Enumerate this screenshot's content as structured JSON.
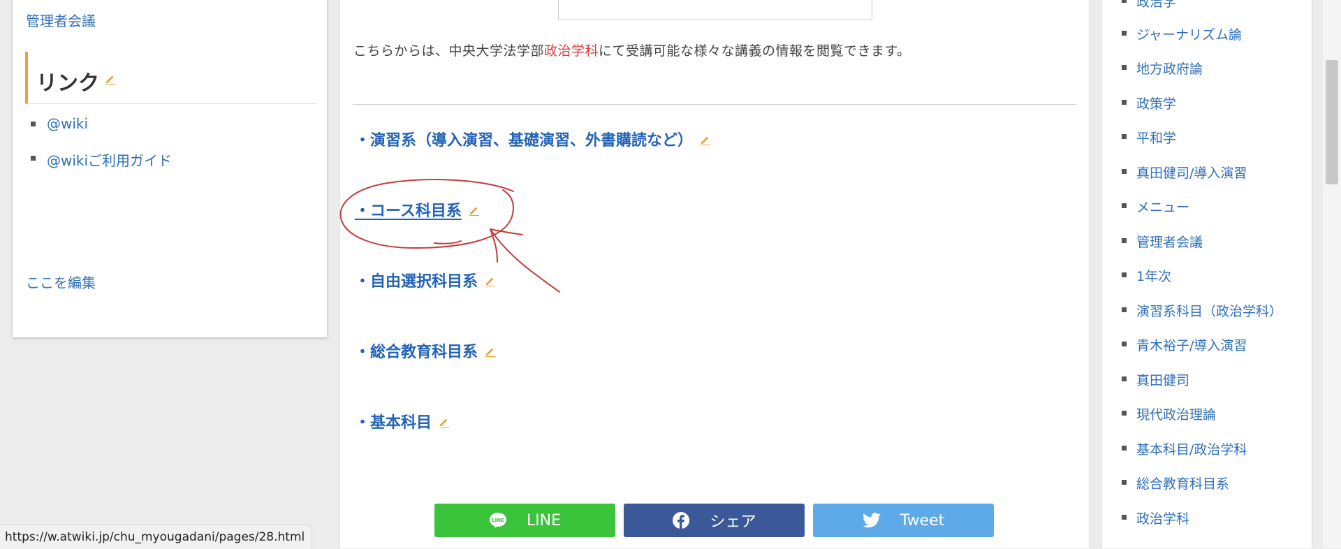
{
  "left_sidebar": {
    "admin_meeting_link": "管理者会議",
    "links_heading": "リンク",
    "link_items": [
      "@wiki",
      "@wikiご利用ガイド"
    ],
    "edit_here": "ここを編集"
  },
  "main": {
    "intro_before": "こちらからは、中央大学法学部",
    "intro_highlight": "政治学科",
    "intro_after": "にて受講可能な様々な講義の情報を閲覧できます。",
    "sections": [
      "・演習系（導入演習、基礎演習、外書購読など）",
      "・コース科目系",
      "・自由選択科目系",
      "・総合教育科目系",
      "・基本科目"
    ]
  },
  "share": {
    "line_label": "LINE",
    "facebook_label": "シェア",
    "twitter_label": "Tweet"
  },
  "right_sidebar": {
    "items": [
      "政治学",
      "ジャーナリズム論",
      "地方政府論",
      "政策学",
      "平和学",
      "真田健司/導入演習",
      "メニュー",
      "管理者会議",
      "1年次",
      "演習系科目（政治学科）",
      "青木裕子/導入演習",
      "真田健司",
      "現代政治理論",
      "基本科目/政治学科",
      "総合教育科目系",
      "政治学科"
    ]
  },
  "status_bar": {
    "url": "https://w.atwiki.jp/chu_myougadani/pages/28.html"
  },
  "colors": {
    "link": "#2f6fb8",
    "heading_link": "#2363b8",
    "accent_orange": "#e8a33d",
    "highlight_red": "#d33d3d",
    "line_green": "#3bc33b",
    "facebook_blue": "#3b5998",
    "twitter_blue": "#5eaae8",
    "annotation_red": "#c43a3a"
  },
  "icons": [
    "pencil-edit-icon",
    "line-logo-icon",
    "facebook-logo-icon",
    "twitter-bird-icon"
  ]
}
